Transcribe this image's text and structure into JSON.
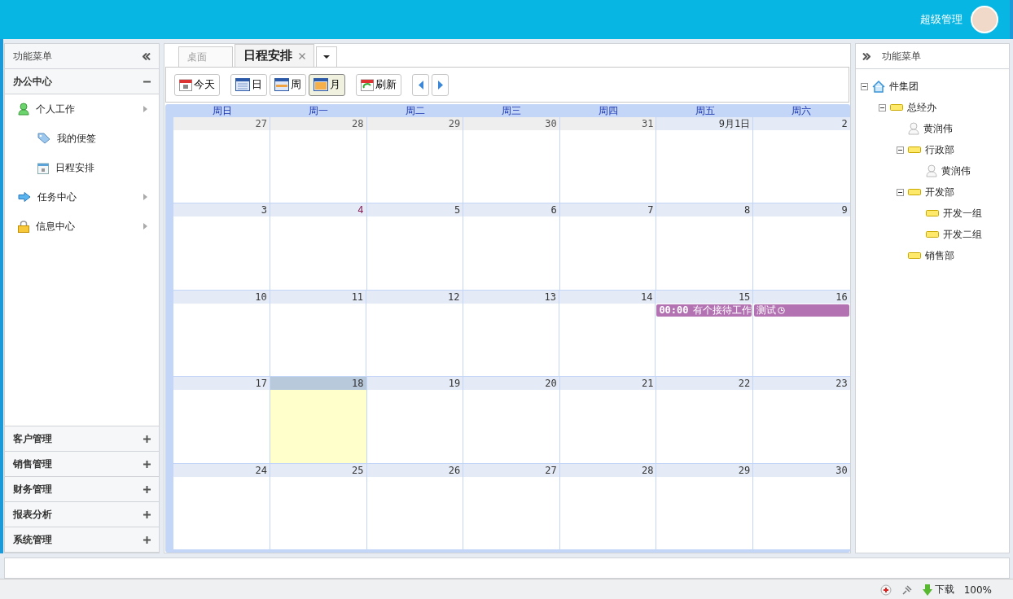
{
  "header": {
    "user": "超级管理"
  },
  "left_panel": {
    "title": "功能菜单",
    "sections_top": [
      {
        "title": "办公中心",
        "expanded": true,
        "items": [
          {
            "label": "个人工作",
            "kind": "person",
            "children": [
              {
                "label": "我的便签",
                "kind": "tag"
              },
              {
                "label": "日程安排",
                "kind": "calendar"
              }
            ]
          },
          {
            "label": "任务中心",
            "kind": "arrow"
          },
          {
            "label": "信息中心",
            "kind": "lock"
          }
        ]
      }
    ],
    "sections_bottom": [
      {
        "title": "客户管理",
        "expanded": false
      },
      {
        "title": "销售管理",
        "expanded": false
      },
      {
        "title": "财务管理",
        "expanded": false
      },
      {
        "title": "报表分析",
        "expanded": false
      },
      {
        "title": "系统管理",
        "expanded": false
      }
    ]
  },
  "tabs": [
    {
      "label": "桌面",
      "selected": false,
      "closable": false
    },
    {
      "label": "日程安排",
      "selected": true,
      "closable": true
    }
  ],
  "toolbar": [
    {
      "label": "今天",
      "kind": "today",
      "selected": false
    },
    {
      "label": "日",
      "kind": "day",
      "selected": false
    },
    {
      "label": "周",
      "kind": "week",
      "selected": false
    },
    {
      "label": "月",
      "kind": "month",
      "selected": true
    },
    {
      "label": "刷新",
      "kind": "refresh",
      "selected": false
    }
  ],
  "calendar": {
    "weekdays": [
      "周日",
      "周一",
      "周二",
      "周三",
      "周四",
      "周五",
      "周六"
    ],
    "weeks": [
      [
        {
          "day": "27",
          "kind": "other"
        },
        {
          "day": "28",
          "kind": "other"
        },
        {
          "day": "29",
          "kind": "other"
        },
        {
          "day": "30",
          "kind": "other"
        },
        {
          "day": "31",
          "kind": "other"
        },
        {
          "day": "9月1日",
          "kind": "current"
        },
        {
          "day": "2",
          "kind": "current"
        }
      ],
      [
        {
          "day": "3",
          "kind": "current"
        },
        {
          "day": "4",
          "kind": "holiday"
        },
        {
          "day": "5",
          "kind": "current"
        },
        {
          "day": "6",
          "kind": "current"
        },
        {
          "day": "7",
          "kind": "current"
        },
        {
          "day": "8",
          "kind": "current"
        },
        {
          "day": "9",
          "kind": "current"
        }
      ],
      [
        {
          "day": "10",
          "kind": "current"
        },
        {
          "day": "11",
          "kind": "current"
        },
        {
          "day": "12",
          "kind": "current"
        },
        {
          "day": "13",
          "kind": "current"
        },
        {
          "day": "14",
          "kind": "current"
        },
        {
          "day": "15",
          "kind": "current",
          "events": [
            {
              "time": "00:00",
              "title": "有个接待工作",
              "color": "#b373b3",
              "reminder": false
            }
          ]
        },
        {
          "day": "16",
          "kind": "current",
          "events": [
            {
              "title": "测试",
              "color": "#b373b3",
              "reminder": true
            }
          ]
        }
      ],
      [
        {
          "day": "17",
          "kind": "current"
        },
        {
          "day": "18",
          "kind": "today"
        },
        {
          "day": "19",
          "kind": "current"
        },
        {
          "day": "20",
          "kind": "current"
        },
        {
          "day": "21",
          "kind": "current"
        },
        {
          "day": "22",
          "kind": "current"
        },
        {
          "day": "23",
          "kind": "current"
        }
      ],
      [
        {
          "day": "24",
          "kind": "current"
        },
        {
          "day": "25",
          "kind": "current"
        },
        {
          "day": "26",
          "kind": "current"
        },
        {
          "day": "27",
          "kind": "current"
        },
        {
          "day": "28",
          "kind": "current"
        },
        {
          "day": "29",
          "kind": "current"
        },
        {
          "day": "30",
          "kind": "current"
        }
      ]
    ]
  },
  "right_panel": {
    "title": "功能菜单",
    "tree": [
      {
        "label": "件集团",
        "kind": "root",
        "expanded": true,
        "children": [
          {
            "label": "总经办",
            "kind": "folder",
            "expanded": true,
            "children": [
              {
                "label": "黄润伟",
                "kind": "person"
              },
              {
                "label": "行政部",
                "kind": "folder",
                "expanded": true,
                "children": [
                  {
                    "label": "黄润伟",
                    "kind": "person"
                  }
                ]
              },
              {
                "label": "开发部",
                "kind": "folder",
                "expanded": true,
                "children": [
                  {
                    "label": "开发一组",
                    "kind": "folder"
                  },
                  {
                    "label": "开发二组",
                    "kind": "folder"
                  }
                ]
              },
              {
                "label": "销售部",
                "kind": "folder"
              }
            ]
          }
        ]
      }
    ]
  },
  "status_bar": {
    "download": "下载",
    "zoom": "100%"
  }
}
